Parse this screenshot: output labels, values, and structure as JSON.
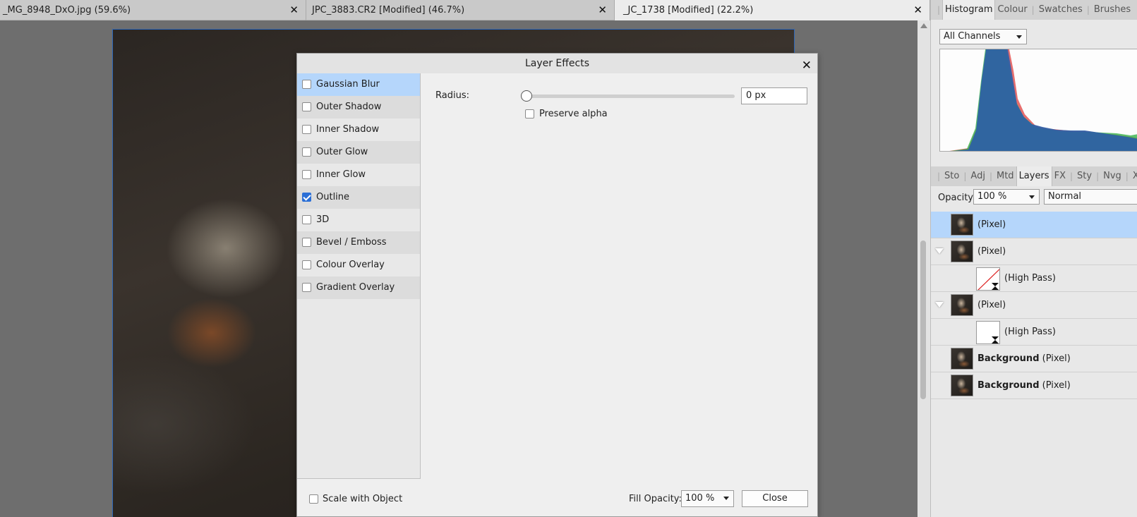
{
  "doc_tabs": [
    {
      "title": "_MG_8948_DxO.jpg (59.6%)",
      "close": "✕"
    },
    {
      "title": "JPC_3883.CR2 [Modified] (46.7%)",
      "close": "✕"
    },
    {
      "title": "_JC_1738 [Modified] (22.2%)",
      "close": "✕"
    }
  ],
  "top_panel_tabs": [
    "Histogram",
    "Colour",
    "Swatches",
    "Brushes"
  ],
  "histogram": {
    "channel": "All Channels",
    "colors": {
      "blue": "#2b5ea8",
      "red": "#e04a4a",
      "green": "#38b24a"
    }
  },
  "studio_tabs": [
    "Sto",
    "Adj",
    "Mtd",
    "Layers",
    "FX",
    "Sty",
    "Nvg",
    "Xfm"
  ],
  "layers_panel": {
    "opacity_label": "Opacity:",
    "opacity_value": "100 %",
    "blend_mode": "Normal",
    "layers": [
      {
        "bold": "",
        "name": "(Pixel)",
        "selected": true
      },
      {
        "bold": "",
        "name": "(Pixel)",
        "expandable": true
      },
      {
        "bold": "",
        "name": "(High Pass)",
        "child": true
      },
      {
        "bold": "",
        "name": "(Pixel)",
        "expandable": true
      },
      {
        "bold": "",
        "name": "(High Pass)",
        "child": true
      },
      {
        "bold": "Background",
        "name": "(Pixel)"
      },
      {
        "bold": "Background",
        "name": "(Pixel)"
      }
    ]
  },
  "dialog": {
    "title": "Layer Effects",
    "close": "✕",
    "effects": [
      {
        "label": "Gaussian Blur",
        "checked": false,
        "selected": true
      },
      {
        "label": "Outer Shadow",
        "checked": false
      },
      {
        "label": "Inner Shadow",
        "checked": false
      },
      {
        "label": "Outer Glow",
        "checked": false
      },
      {
        "label": "Inner Glow",
        "checked": false
      },
      {
        "label": "Outline",
        "checked": true
      },
      {
        "label": "3D",
        "checked": false
      },
      {
        "label": "Bevel / Emboss",
        "checked": false
      },
      {
        "label": "Colour Overlay",
        "checked": false
      },
      {
        "label": "Gradient Overlay",
        "checked": false
      }
    ],
    "radius_label": "Radius:",
    "radius_value": "0 px",
    "radius_fraction": 0,
    "preserve_alpha_label": "Preserve alpha",
    "scale_with_object_label": "Scale with Object",
    "fill_opacity_label": "Fill Opacity:",
    "fill_opacity_value": "100 %",
    "close_button": "Close",
    "accent_color": "#b5d6fb"
  }
}
